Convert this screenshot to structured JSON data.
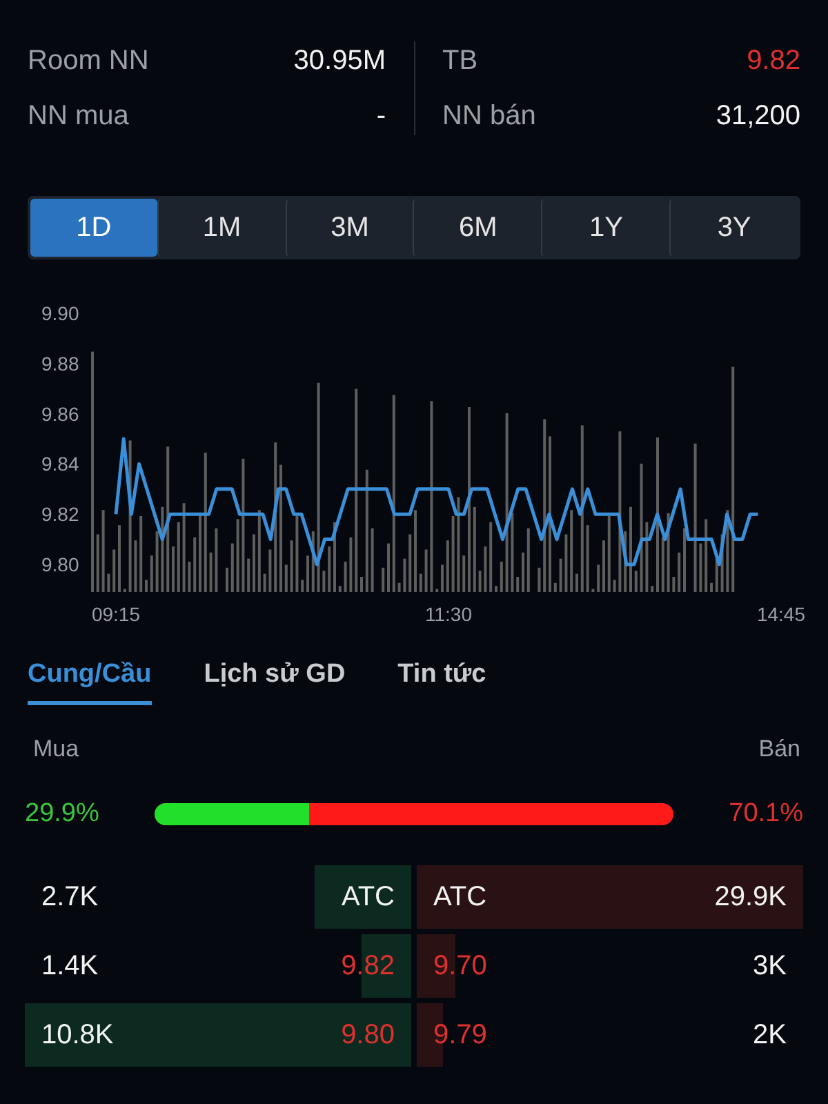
{
  "stats": [
    {
      "label": "Room NN",
      "value": "30.95M",
      "color": "#f2f2f2"
    },
    {
      "label": "TB",
      "value": "9.82",
      "color": "#e0302e"
    },
    {
      "label": "NN mua",
      "value": "-",
      "color": "#f2f2f2"
    },
    {
      "label": "NN bán",
      "value": "31,200",
      "color": "#f2f2f2"
    }
  ],
  "periods": [
    {
      "label": "1D",
      "selected": true
    },
    {
      "label": "1M",
      "selected": false
    },
    {
      "label": "3M",
      "selected": false
    },
    {
      "label": "6M",
      "selected": false
    },
    {
      "label": "1Y",
      "selected": false
    },
    {
      "label": "3Y",
      "selected": false
    }
  ],
  "chart": {
    "chart_data": {
      "type": "line",
      "ylim": [
        9.8,
        9.9
      ],
      "yticks": [
        {
          "value": 9.8,
          "label": "9.80"
        },
        {
          "value": 9.82,
          "label": "9.82"
        },
        {
          "value": 9.84,
          "label": "9.84"
        },
        {
          "value": 9.86,
          "label": "9.86"
        },
        {
          "value": 9.88,
          "label": "9.88"
        },
        {
          "value": 9.9,
          "label": "9.90"
        }
      ],
      "categories": [
        "09:15",
        null,
        null,
        null,
        null,
        null,
        null,
        null,
        null,
        null,
        null,
        null,
        null,
        null,
        null,
        null,
        null,
        null,
        null,
        null,
        null,
        null,
        null,
        null,
        null,
        null,
        null,
        null,
        null,
        null,
        null,
        null,
        null,
        null,
        null,
        null,
        null,
        null,
        null,
        null,
        null,
        null,
        null,
        "11:30",
        null,
        null,
        null,
        null,
        null,
        null,
        null,
        null,
        null,
        null,
        null,
        null,
        null,
        null,
        null,
        null,
        null,
        null,
        null,
        null,
        null,
        null,
        null,
        null,
        null,
        null,
        null,
        null,
        null,
        null,
        null,
        null,
        null,
        null,
        null,
        null,
        null,
        null,
        null,
        null,
        null,
        null,
        "14:45"
      ],
      "series": [
        {
          "color": "#3a8fd8",
          "values": [
            9.82,
            9.85,
            9.82,
            9.84,
            9.83,
            9.82,
            9.81,
            9.82,
            9.82,
            9.82,
            9.82,
            9.82,
            9.82,
            9.83,
            9.83,
            9.83,
            9.82,
            9.82,
            9.82,
            9.82,
            9.81,
            9.83,
            9.83,
            9.82,
            9.82,
            9.81,
            9.8,
            9.81,
            9.81,
            9.82,
            9.83,
            9.83,
            9.83,
            9.83,
            9.83,
            9.83,
            9.82,
            9.82,
            9.82,
            9.83,
            9.83,
            9.83,
            9.83,
            9.83,
            9.82,
            9.82,
            9.83,
            9.83,
            9.83,
            9.82,
            9.81,
            9.82,
            9.83,
            9.83,
            9.82,
            9.81,
            9.82,
            9.81,
            9.82,
            9.83,
            9.82,
            9.83,
            9.82,
            9.82,
            9.82,
            9.82,
            9.8,
            9.8,
            9.81,
            9.81,
            9.82,
            9.81,
            9.82,
            9.83,
            9.81,
            9.81,
            9.81,
            9.81,
            9.8,
            9.82,
            9.81,
            9.81,
            9.82,
            9.82,
            null,
            null,
            null
          ]
        }
      ]
    }
  },
  "tabs": [
    {
      "label": "Cung/Cầu",
      "selected": true
    },
    {
      "label": "Lịch sử GD",
      "selected": false
    },
    {
      "label": "Tin tức",
      "selected": false
    }
  ],
  "balance": {
    "buy_label": "Mua",
    "sell_label": "Bán",
    "buy_pct": "29.9%",
    "sell_pct": "70.1%",
    "level": 0.299
  },
  "book": [
    {
      "bid": {
        "volume": "2.7K",
        "price": "ATC",
        "color": "#f2f2f2"
      },
      "ask": {
        "price": "ATC",
        "color": "#f2f2f2",
        "volume": "29.9K"
      }
    },
    {
      "bid": {
        "volume": "1.4K",
        "price": "9.82",
        "color": "#e0302e"
      },
      "ask": {
        "price": "9.70",
        "color": "#e0302e",
        "volume": "3K"
      }
    },
    {
      "bid": {
        "volume": "10.8K",
        "price": "9.80",
        "color": "#e0302e"
      },
      "ask": {
        "price": "9.79",
        "color": "#e0302e",
        "volume": "2K"
      }
    }
  ]
}
